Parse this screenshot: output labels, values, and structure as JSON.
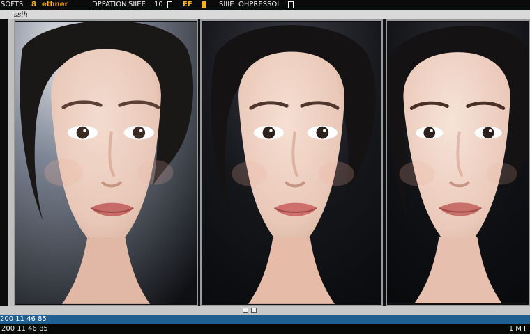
{
  "window": {
    "menu_items": [
      "SOFTS",
      "8",
      "ethner",
      "DPPATION",
      "SIIEE",
      "10",
      "EF",
      "SIIIE",
      "OHPRESSOL"
    ],
    "panel_title": "ssih"
  },
  "status": {
    "left_code": "200 11 46 85",
    "right_code": "1 M I"
  },
  "colors": {
    "accent": "#ffb21a",
    "status_blue": "#1f5f92"
  },
  "icons": [
    "window-icon",
    "tool-icon",
    "lock-icon",
    "info-icon"
  ]
}
